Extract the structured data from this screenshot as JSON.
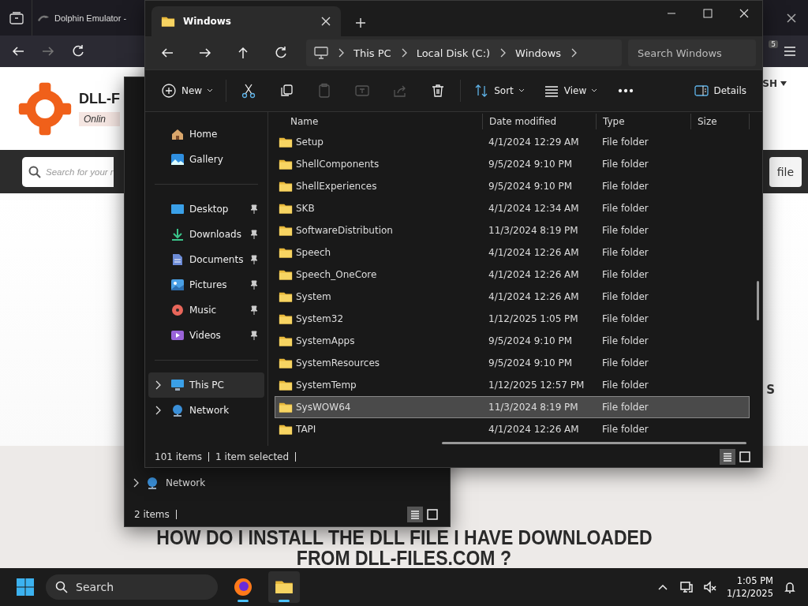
{
  "browser": {
    "tab": {
      "title": "Dolphin Emulator -"
    },
    "extension_badge": "5",
    "site": {
      "brand": "DLL-F",
      "tagline": "Onlin",
      "language": "SH",
      "search": {
        "placeholder": "Search for your r"
      },
      "search_button": "file",
      "side_text": "S",
      "heading": [
        "HOW DO I INSTALL THE DLL FILE I HAVE DOWNLOADED",
        "FROM DLL-FILES.COM ?"
      ]
    }
  },
  "back_explorer": {
    "sidebar": [
      {
        "label": "Network",
        "kind": "network"
      }
    ],
    "status": "2 items",
    "views": [
      {
        "kind": "details",
        "selected": true
      },
      {
        "kind": "tiles",
        "selected": false
      }
    ]
  },
  "explorer": {
    "tab": {
      "title": "Windows"
    },
    "breadcrumb": [
      "This PC",
      "Local Disk (C:)",
      "Windows"
    ],
    "search": {
      "placeholder": "Search Windows"
    },
    "toolbar": [
      {
        "kind": "new",
        "label": "New",
        "disabled": false
      },
      {
        "kind": "cut",
        "disabled": false
      },
      {
        "kind": "copy",
        "disabled": false
      },
      {
        "kind": "paste",
        "disabled": true
      },
      {
        "kind": "rename",
        "disabled": true
      },
      {
        "kind": "share",
        "disabled": true
      },
      {
        "kind": "delete",
        "disabled": false
      },
      {
        "kind": "sort",
        "label": "Sort",
        "disabled": false
      },
      {
        "kind": "view",
        "label": "View",
        "disabled": false
      },
      {
        "kind": "more",
        "disabled": false
      }
    ],
    "details_button": "Details",
    "sidebar": [
      {
        "label": "Home",
        "kind": "home",
        "pinned": false,
        "expandable": false,
        "selected": false
      },
      {
        "label": "Gallery",
        "kind": "gallery",
        "pinned": false,
        "expandable": false,
        "selected": false
      },
      {
        "label": "Desktop",
        "kind": "desktop",
        "pinned": true,
        "expandable": false,
        "selected": false
      },
      {
        "label": "Downloads",
        "kind": "downloads",
        "pinned": true,
        "expandable": false,
        "selected": false
      },
      {
        "label": "Documents",
        "kind": "documents",
        "pinned": true,
        "expandable": false,
        "selected": false
      },
      {
        "label": "Pictures",
        "kind": "pictures",
        "pinned": true,
        "expandable": false,
        "selected": false
      },
      {
        "label": "Music",
        "kind": "music",
        "pinned": true,
        "expandable": false,
        "selected": false
      },
      {
        "label": "Videos",
        "kind": "videos",
        "pinned": true,
        "expandable": false,
        "selected": false
      },
      {
        "label": "This PC",
        "kind": "pc",
        "pinned": false,
        "expandable": true,
        "selected": true
      },
      {
        "label": "Network",
        "kind": "network",
        "pinned": false,
        "expandable": true,
        "selected": false
      }
    ],
    "columns": [
      "Name",
      "Date modified",
      "Type",
      "Size"
    ],
    "rows": [
      {
        "name": "Setup",
        "date": "4/1/2024 12:29 AM",
        "type": "File folder",
        "selected": false
      },
      {
        "name": "ShellComponents",
        "date": "9/5/2024 9:10 PM",
        "type": "File folder",
        "selected": false
      },
      {
        "name": "ShellExperiences",
        "date": "9/5/2024 9:10 PM",
        "type": "File folder",
        "selected": false
      },
      {
        "name": "SKB",
        "date": "4/1/2024 12:34 AM",
        "type": "File folder",
        "selected": false
      },
      {
        "name": "SoftwareDistribution",
        "date": "11/3/2024 8:19 PM",
        "type": "File folder",
        "selected": false
      },
      {
        "name": "Speech",
        "date": "4/1/2024 12:26 AM",
        "type": "File folder",
        "selected": false
      },
      {
        "name": "Speech_OneCore",
        "date": "4/1/2024 12:26 AM",
        "type": "File folder",
        "selected": false
      },
      {
        "name": "System",
        "date": "4/1/2024 12:26 AM",
        "type": "File folder",
        "selected": false
      },
      {
        "name": "System32",
        "date": "1/12/2025 1:05 PM",
        "type": "File folder",
        "selected": false
      },
      {
        "name": "SystemApps",
        "date": "9/5/2024 9:10 PM",
        "type": "File folder",
        "selected": false
      },
      {
        "name": "SystemResources",
        "date": "9/5/2024 9:10 PM",
        "type": "File folder",
        "selected": false
      },
      {
        "name": "SystemTemp",
        "date": "1/12/2025 12:57 PM",
        "type": "File folder",
        "selected": false
      },
      {
        "name": "SysWOW64",
        "date": "11/3/2024 8:19 PM",
        "type": "File folder",
        "selected": true
      },
      {
        "name": "TAPI",
        "date": "4/1/2024 12:26 AM",
        "type": "File folder",
        "selected": false
      }
    ],
    "status": [
      "101 items",
      "1 item selected"
    ],
    "views": [
      {
        "kind": "details",
        "selected": true
      },
      {
        "kind": "tiles",
        "selected": false
      }
    ]
  },
  "taskbar": {
    "search": {
      "placeholder": "Search"
    },
    "apps": [
      {
        "kind": "browser",
        "active": false
      },
      {
        "kind": "files",
        "active": true
      }
    ],
    "time": "1:05 PM",
    "date": "1/12/2025"
  }
}
